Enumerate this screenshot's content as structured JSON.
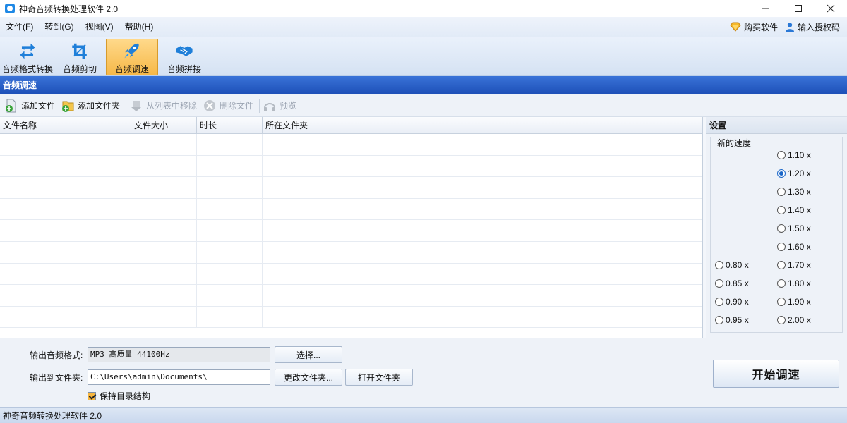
{
  "window": {
    "title": "神奇音频转换处理软件 2.0",
    "controls": {
      "minimize": "—",
      "maximize": "☐",
      "close": "✕"
    }
  },
  "menu": {
    "items": [
      {
        "label": "文件(F)"
      },
      {
        "label": "转到(G)"
      },
      {
        "label": "视图(V)"
      },
      {
        "label": "帮助(H)"
      }
    ],
    "buy": "购买软件",
    "license": "输入授权码"
  },
  "toolbar": {
    "items": [
      {
        "label": "音频格式转换",
        "icon": "convert-icon"
      },
      {
        "label": "音频剪切",
        "icon": "crop-icon"
      },
      {
        "label": "音频调速",
        "icon": "rocket-icon",
        "active": true
      },
      {
        "label": "音频拼接",
        "icon": "handshake-icon"
      }
    ]
  },
  "section": {
    "title": "音频调速"
  },
  "subtoolbar": {
    "add_file": "添加文件",
    "add_folder": "添加文件夹",
    "remove_from_list": "从列表中移除",
    "delete_file": "删除文件",
    "preview": "预览"
  },
  "table": {
    "columns": [
      "文件名称",
      "文件大小",
      "时长",
      "所在文件夹"
    ],
    "rows": []
  },
  "settings": {
    "title": "设置",
    "speed_label": "新的速度",
    "selected": "1.20 x",
    "options_left": [
      "0.80 x",
      "0.85 x",
      "0.90 x",
      "0.95 x"
    ],
    "options_right": [
      "1.10 x",
      "1.20 x",
      "1.30 x",
      "1.40 x",
      "1.50 x",
      "1.60 x",
      "1.70 x",
      "1.80 x",
      "1.90 x",
      "2.00 x"
    ]
  },
  "output": {
    "format_label": "输出音频格式:",
    "format_value": "MP3 高质量 44100Hz",
    "select_button": "选择...",
    "folder_label": "输出到文件夹:",
    "folder_value": "C:\\Users\\admin\\Documents\\",
    "change_folder_button": "更改文件夹...",
    "open_folder_button": "打开文件夹",
    "keep_structure": "保持目录结构",
    "keep_structure_checked": true
  },
  "start_button": "开始调速",
  "status": "神奇音频转换处理软件 2.0",
  "colors": {
    "accent": "#1c4fb7",
    "active_tab": "#f6b848"
  }
}
